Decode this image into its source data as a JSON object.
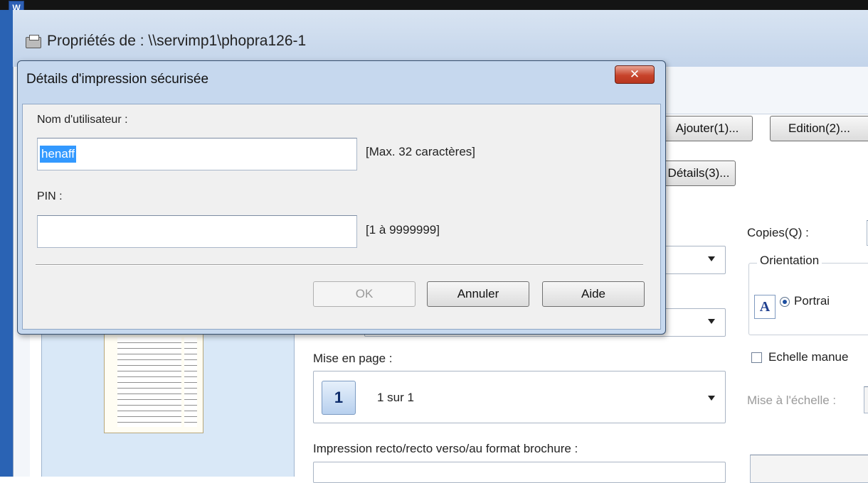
{
  "window": {
    "title": "Propriétés de : \\\\servimp1\\phopra126-1"
  },
  "background_app": {
    "icon_label": "W"
  },
  "toolbar_buttons": {
    "add_label": "Ajouter(1)...",
    "edit_label": "Edition(2)...",
    "details_label": "Détails(3)..."
  },
  "settings": {
    "copies_label": "Copies(Q) :",
    "orientation_label": "Orientation",
    "portrait_label": "Portrai",
    "portrait_icon_glyph": "A",
    "manual_scale_label": "Echelle manue",
    "scale_label": "Mise à l'échelle :",
    "page_layout_label": "Mise en page :",
    "page_layout_value": "1 sur 1",
    "page_layout_icon_glyph": "1",
    "duplex_label": "Impression recto/recto verso/au format brochure :"
  },
  "dialog": {
    "title": "Détails d'impression sécurisée",
    "close_glyph": "✕",
    "username_label": "Nom d'utilisateur :",
    "username_value": "henaff",
    "username_hint": "[Max. 32 caractères]",
    "pin_label": "PIN :",
    "pin_value": "",
    "pin_hint": "[1 à 9999999]",
    "ok_label": "OK",
    "cancel_label": "Annuler",
    "help_label": "Aide"
  },
  "colors": {
    "selection": "#3399ff",
    "close_button": "#c7432b",
    "dialog_frame": "#c6d8ee"
  }
}
